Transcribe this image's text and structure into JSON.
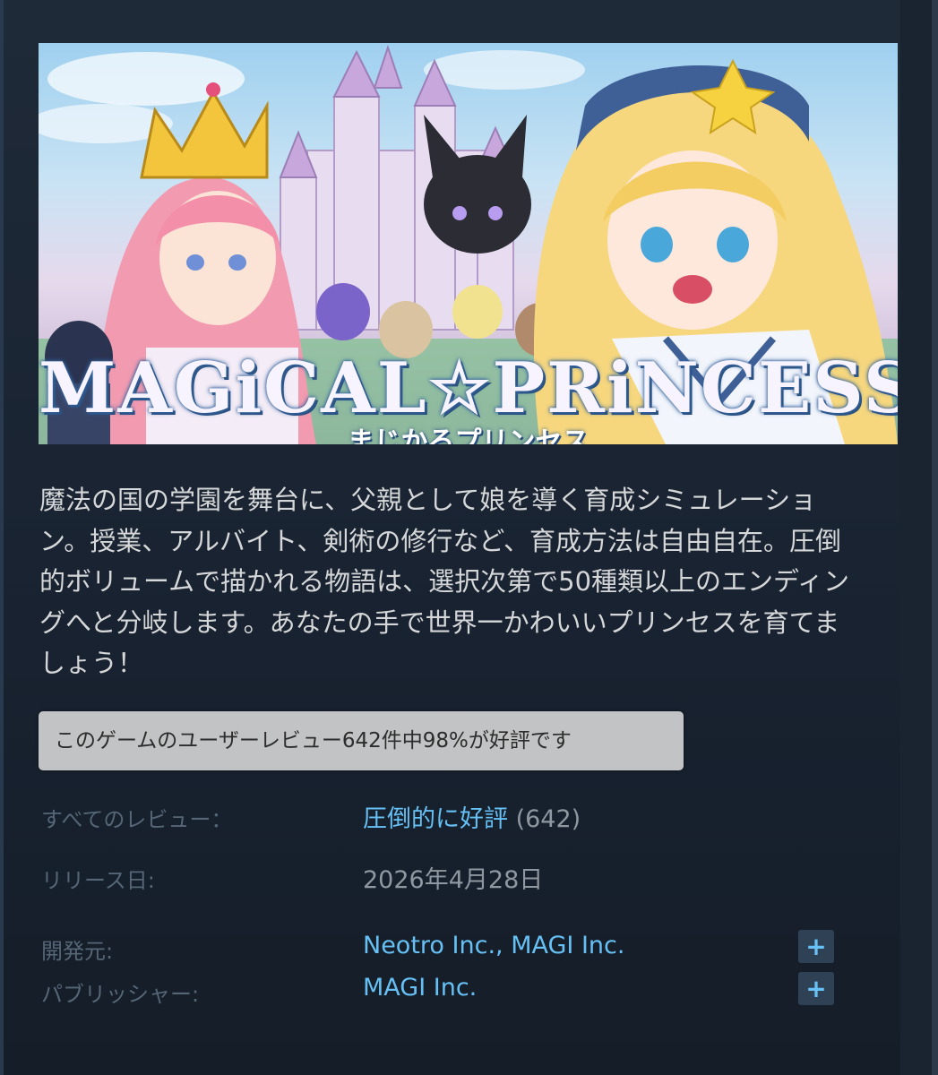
{
  "banner": {
    "logo_main": "MAGiCAL☆PRiNCESS",
    "logo_sub": "まじかるプリンセス"
  },
  "description": "魔法の国の学園を舞台に、父親として娘を導く育成シミュレーション。授業、アルバイト、剣術の修行など、育成方法は自由自在。圧倒的ボリュームで描かれる物語は、選択次第で50種類以上のエンディングへと分岐します。あなたの手で世界一かわいいプリンセスを育てましょう！",
  "tooltip": "このゲームのユーザーレビュー642件中98%が好評です",
  "reviews": {
    "label": "すべてのレビュー：",
    "summary": "圧倒的に好評",
    "count": "(642)"
  },
  "release": {
    "label": "リリース日:",
    "date": "2026年4月28日"
  },
  "developer": {
    "label": "開発元:",
    "value": "Neotro Inc., MAGI Inc.",
    "plus": "+"
  },
  "publisher": {
    "label": "パブリッシャー:",
    "value": "MAGI Inc.",
    "plus": "+"
  },
  "colors": {
    "link": "#66c0f4",
    "background": "#1b2838",
    "tooltip_bg": "#c2c3c4"
  }
}
